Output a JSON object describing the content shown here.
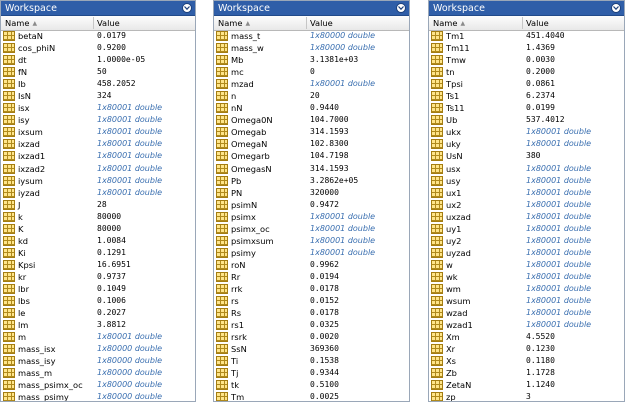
{
  "panels": [
    {
      "title": "Workspace",
      "col_name": "Name",
      "col_value": "Value",
      "rows": [
        {
          "name": "betaN",
          "value": "0.0179"
        },
        {
          "name": "cos_phiN",
          "value": "0.9200"
        },
        {
          "name": "dt",
          "value": "1.0000e-05"
        },
        {
          "name": "fN",
          "value": "50"
        },
        {
          "name": "Ib",
          "value": "458.2052"
        },
        {
          "name": "IsN",
          "value": "324"
        },
        {
          "name": "isx",
          "value": "1x80001 double"
        },
        {
          "name": "isy",
          "value": "1x80001 double"
        },
        {
          "name": "ixsum",
          "value": "1x80001 double"
        },
        {
          "name": "ixzad",
          "value": "1x80001 double"
        },
        {
          "name": "ixzad1",
          "value": "1x80001 double"
        },
        {
          "name": "ixzad2",
          "value": "1x80001 double"
        },
        {
          "name": "iysum",
          "value": "1x80001 double"
        },
        {
          "name": "iyzad",
          "value": "1x80001 double"
        },
        {
          "name": "J",
          "value": "28"
        },
        {
          "name": "k",
          "value": "80000"
        },
        {
          "name": "K",
          "value": "80000"
        },
        {
          "name": "kd",
          "value": "1.0084"
        },
        {
          "name": "Ki",
          "value": "0.1291"
        },
        {
          "name": "Kpsi",
          "value": "16.6951"
        },
        {
          "name": "kr",
          "value": "0.9737"
        },
        {
          "name": "lbr",
          "value": "0.1049"
        },
        {
          "name": "lbs",
          "value": "0.1006"
        },
        {
          "name": "le",
          "value": "0.2027"
        },
        {
          "name": "lm",
          "value": "3.8812"
        },
        {
          "name": "m",
          "value": "1x80001 double"
        },
        {
          "name": "mass_isx",
          "value": "1x80000 double"
        },
        {
          "name": "mass_isy",
          "value": "1x80000 double"
        },
        {
          "name": "mass_m",
          "value": "1x80000 double"
        },
        {
          "name": "mass_psimx_oc",
          "value": "1x80000 double"
        },
        {
          "name": "mass_psimy",
          "value": "1x80000 double"
        }
      ]
    },
    {
      "title": "Workspace",
      "col_name": "Name",
      "col_value": "Value",
      "rows": [
        {
          "name": "mass_t",
          "value": "1x80000 double"
        },
        {
          "name": "mass_w",
          "value": "1x80000 double"
        },
        {
          "name": "Mb",
          "value": "3.1381e+03"
        },
        {
          "name": "mc",
          "value": "0"
        },
        {
          "name": "mzad",
          "value": "1x80001 double"
        },
        {
          "name": "n",
          "value": "20"
        },
        {
          "name": "nN",
          "value": "0.9440"
        },
        {
          "name": "Omega0N",
          "value": "104.7000"
        },
        {
          "name": "Omegab",
          "value": "314.1593"
        },
        {
          "name": "OmegaN",
          "value": "102.8300"
        },
        {
          "name": "Omegarb",
          "value": "104.7198"
        },
        {
          "name": "OmegasN",
          "value": "314.1593"
        },
        {
          "name": "Pb",
          "value": "3.2862e+05"
        },
        {
          "name": "PN",
          "value": "320000"
        },
        {
          "name": "psimN",
          "value": "0.9472"
        },
        {
          "name": "psimx",
          "value": "1x80001 double"
        },
        {
          "name": "psimx_oc",
          "value": "1x80001 double"
        },
        {
          "name": "psimxsum",
          "value": "1x80001 double"
        },
        {
          "name": "psimy",
          "value": "1x80001 double"
        },
        {
          "name": "roN",
          "value": "0.9962"
        },
        {
          "name": "Rr",
          "value": "0.0194"
        },
        {
          "name": "rrk",
          "value": "0.0178"
        },
        {
          "name": "rs",
          "value": "0.0152"
        },
        {
          "name": "Rs",
          "value": "0.0178"
        },
        {
          "name": "rs1",
          "value": "0.0325"
        },
        {
          "name": "rsrk",
          "value": "0.0020"
        },
        {
          "name": "SsN",
          "value": "369360"
        },
        {
          "name": "Ti",
          "value": "0.1538"
        },
        {
          "name": "Tj",
          "value": "0.9344"
        },
        {
          "name": "tk",
          "value": "0.5100"
        },
        {
          "name": "Tm",
          "value": "0.0025"
        }
      ]
    },
    {
      "title": "Workspace",
      "col_name": "Name",
      "col_value": "Value",
      "rows": [
        {
          "name": "Tm1",
          "value": "451.4040"
        },
        {
          "name": "Tm11",
          "value": "1.4369"
        },
        {
          "name": "Tmw",
          "value": "0.0030"
        },
        {
          "name": "tn",
          "value": "0.2000"
        },
        {
          "name": "Tpsi",
          "value": "0.0861"
        },
        {
          "name": "Ts1",
          "value": "6.2374"
        },
        {
          "name": "Ts11",
          "value": "0.0199"
        },
        {
          "name": "Ub",
          "value": "537.4012"
        },
        {
          "name": "ukx",
          "value": "1x80001 double"
        },
        {
          "name": "uky",
          "value": "1x80001 double"
        },
        {
          "name": "UsN",
          "value": "380"
        },
        {
          "name": "usx",
          "value": "1x80001 double"
        },
        {
          "name": "usy",
          "value": "1x80001 double"
        },
        {
          "name": "ux1",
          "value": "1x80001 double"
        },
        {
          "name": "ux2",
          "value": "1x80001 double"
        },
        {
          "name": "uxzad",
          "value": "1x80001 double"
        },
        {
          "name": "uy1",
          "value": "1x80001 double"
        },
        {
          "name": "uy2",
          "value": "1x80001 double"
        },
        {
          "name": "uyzad",
          "value": "1x80001 double"
        },
        {
          "name": "w",
          "value": "1x80001 double"
        },
        {
          "name": "wk",
          "value": "1x80001 double"
        },
        {
          "name": "wm",
          "value": "1x80001 double"
        },
        {
          "name": "wsum",
          "value": "1x80001 double"
        },
        {
          "name": "wzad",
          "value": "1x80001 double"
        },
        {
          "name": "wzad1",
          "value": "1x80001 double"
        },
        {
          "name": "Xm",
          "value": "4.5520"
        },
        {
          "name": "Xr",
          "value": "0.1230"
        },
        {
          "name": "Xs",
          "value": "0.1180"
        },
        {
          "name": "Zb",
          "value": "1.1728"
        },
        {
          "name": "ZetaN",
          "value": "1.1240"
        },
        {
          "name": "zp",
          "value": "3"
        }
      ]
    }
  ],
  "icons": {
    "panel_menu": "chevron-down-circle-icon",
    "variable": "matrix-variable-icon",
    "sort": "sort-ascending-icon"
  },
  "colors": {
    "titlebar": "#2f5ea8",
    "double_value": "#3a6fb0",
    "icon_fill": "#ffe58a"
  }
}
